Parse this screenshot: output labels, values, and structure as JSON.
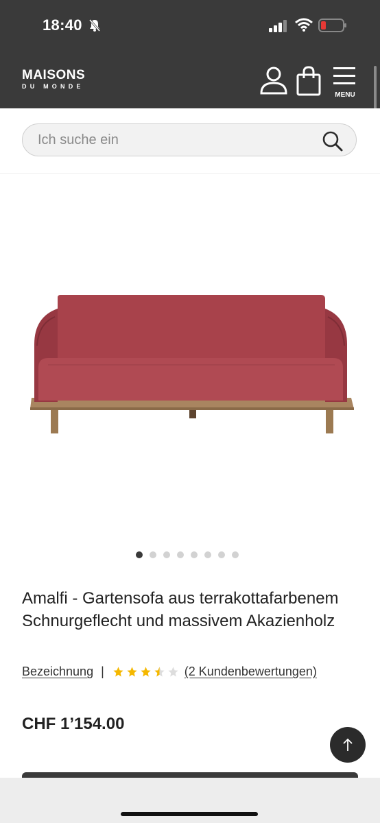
{
  "status_bar": {
    "time": "18:40"
  },
  "header": {
    "logo_main": "MAISONS",
    "logo_sub": "DU MONDE",
    "menu_label": "MENU"
  },
  "search": {
    "placeholder": "Ich suche ein"
  },
  "gallery": {
    "image_count": 8,
    "active_index": 0
  },
  "product": {
    "title": "Amalfi - Gartensofa aus terrakottafarbenem Schnurgeflecht und massivem Akazienholz",
    "description_link": "Bezeichnung",
    "separator": "|",
    "rating": 3.5,
    "rating_max": 5,
    "reviews_link": "(2 Kundenbewertungen)",
    "price": "CHF 1’154.00"
  },
  "colors": {
    "header_bg": "#3a3a3a",
    "star": "#f5b800",
    "star_empty": "#dddddd",
    "sofa": "#a8424b",
    "battery_low": "#e53935"
  }
}
